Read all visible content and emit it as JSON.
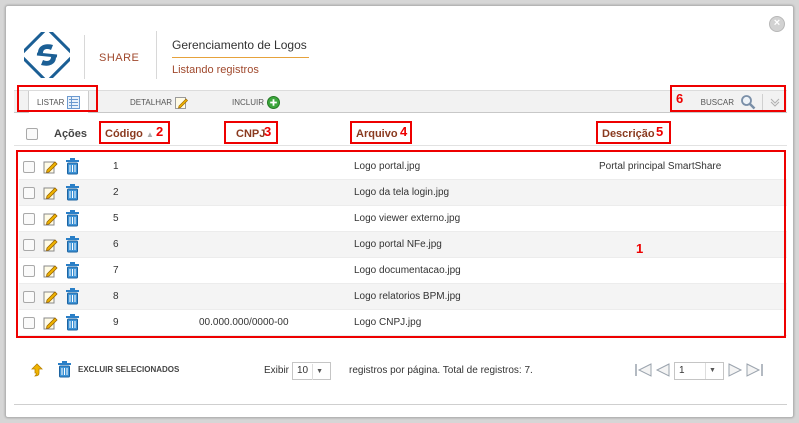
{
  "app": {
    "brand": "SHARE"
  },
  "header": {
    "title": "Gerenciamento de Logos",
    "subtitle": "Listando registros"
  },
  "tabs": [
    {
      "label": "LISTAR",
      "icon": "list-icon"
    },
    {
      "label": "DETALHAR",
      "icon": "edit-icon"
    },
    {
      "label": "INCLUIR",
      "icon": "add-icon"
    }
  ],
  "search": {
    "label": "BUSCAR",
    "icon": "magnifier-icon",
    "toggle_icon": "chevron-down-icon"
  },
  "columns": {
    "acoes": "Ações",
    "codigo": "Código",
    "cnpj": "CNPJ",
    "arquivo": "Arquivo",
    "descricao": "Descrição"
  },
  "rows": [
    {
      "codigo": "1",
      "cnpj": "",
      "arquivo": "Logo portal.jpg",
      "descricao": "Portal principal SmartShare"
    },
    {
      "codigo": "2",
      "cnpj": "",
      "arquivo": "Logo da tela login.jpg",
      "descricao": ""
    },
    {
      "codigo": "5",
      "cnpj": "",
      "arquivo": "Logo viewer externo.jpg",
      "descricao": ""
    },
    {
      "codigo": "6",
      "cnpj": "",
      "arquivo": "Logo portal NFe.jpg",
      "descricao": ""
    },
    {
      "codigo": "7",
      "cnpj": "",
      "arquivo": "Logo documentacao.jpg",
      "descricao": ""
    },
    {
      "codigo": "8",
      "cnpj": "",
      "arquivo": "Logo relatorios BPM.jpg",
      "descricao": ""
    },
    {
      "codigo": "9",
      "cnpj": "00.000.000/0000-00",
      "arquivo": "Logo CNPJ.jpg",
      "descricao": ""
    }
  ],
  "footer": {
    "delete_selected": "EXCLUIR SELECIONADOS",
    "show_label": "Exibir",
    "per_page": "10",
    "per_page_suffix": "registros por página. Total de registros: 7.",
    "page": "1"
  },
  "annotations": {
    "n1": "1",
    "n2": "2",
    "n3": "3",
    "n4": "4",
    "n5": "5",
    "n6": "6"
  },
  "colors": {
    "accent": "#a0492d",
    "highlight": "#ee0000",
    "icon_blue": "#2a7fc7"
  }
}
